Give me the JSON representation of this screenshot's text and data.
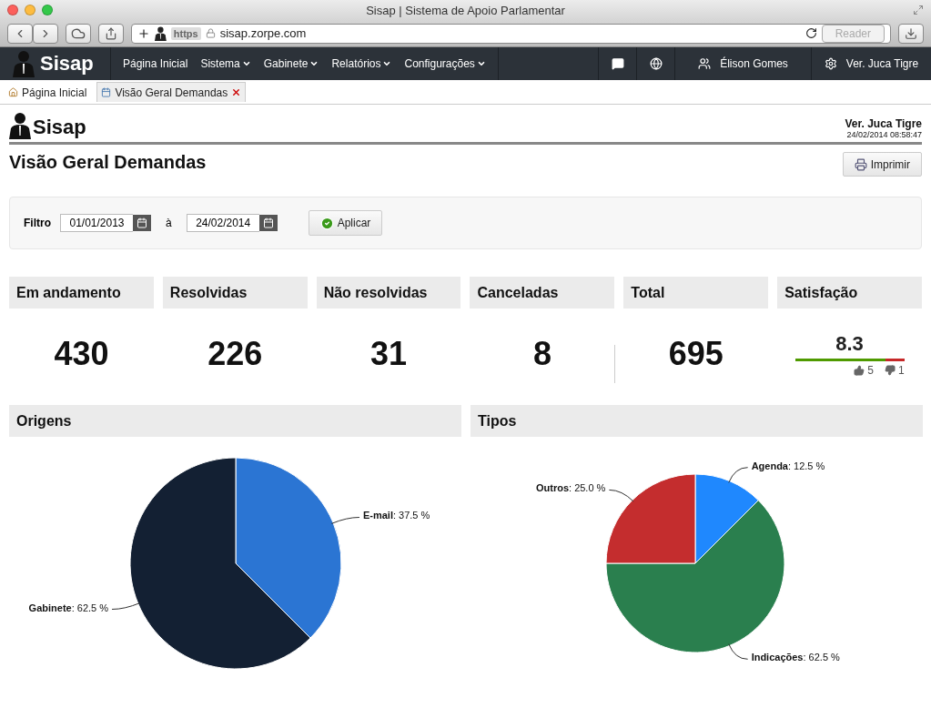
{
  "window": {
    "title": "Sisap | Sistema de Apoio Parlamentar"
  },
  "browser": {
    "protocol": "https",
    "url": "sisap.zorpe.com",
    "reader": "Reader"
  },
  "nav": {
    "brand": "Sisap",
    "items": [
      {
        "label": "Página Inicial",
        "dropdown": false
      },
      {
        "label": "Sistema",
        "dropdown": true
      },
      {
        "label": "Gabinete",
        "dropdown": true
      },
      {
        "label": "Relatórios",
        "dropdown": true
      },
      {
        "label": "Configurações",
        "dropdown": true
      }
    ],
    "user": "Élison Gomes",
    "account": "Ver. Juca Tigre"
  },
  "tabs": [
    {
      "label": "Página Inicial",
      "selected": false,
      "closable": false
    },
    {
      "label": "Visão Geral Demandas",
      "selected": true,
      "closable": true
    }
  ],
  "header": {
    "brand": "Sisap",
    "name": "Ver. Juca Tigre",
    "datetime": "24/02/2014 08:58:47"
  },
  "page": {
    "title": "Visão Geral Demandas",
    "print_button": "Imprimir"
  },
  "filter": {
    "label": "Filtro",
    "from": "01/01/2013",
    "separator": "à",
    "to": "24/02/2014",
    "apply": "Aplicar"
  },
  "stats": [
    {
      "kind": "count",
      "label": "Em andamento",
      "value": "430"
    },
    {
      "kind": "count",
      "label": "Resolvidas",
      "value": "226"
    },
    {
      "kind": "count",
      "label": "Não resolvidas",
      "value": "31"
    },
    {
      "kind": "count",
      "label": "Canceladas",
      "value": "8"
    },
    {
      "kind": "total",
      "label": "Total",
      "value": "695"
    },
    {
      "kind": "rating",
      "label": "Satisfação",
      "value": "8.3",
      "level": 0.83,
      "up": "5",
      "down": "1"
    }
  ],
  "charts": [
    {
      "title": "Origens",
      "chart_data": {
        "type": "pie",
        "values": [
          37.5,
          62.5
        ],
        "colors": [
          "#2b75d3",
          "#132033"
        ],
        "value_labels": [
          "**E-mail**: 37.5 %",
          "**Gabinete**: 62.5 %"
        ]
      }
    },
    {
      "title": "Tipos",
      "chart_data": {
        "type": "pie",
        "values": [
          12.5,
          62.5,
          25.0
        ],
        "colors": [
          "#1f88fe",
          "#2a7f4e",
          "#c42d2e"
        ],
        "value_labels": [
          "**Agenda**: 12.5 %",
          "**Indicações**: 62.5 %",
          "**Outros**: 25.0 %"
        ]
      }
    }
  ]
}
